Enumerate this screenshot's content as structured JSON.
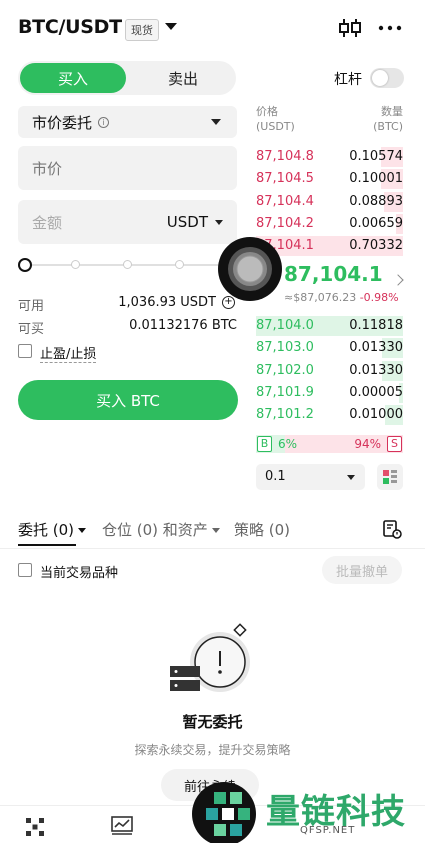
{
  "header": {
    "pair": "BTC/USDT",
    "badge": "现货"
  },
  "trade_panel": {
    "buy_tab": "买入",
    "sell_tab": "卖出",
    "leverage_label": "杠杆",
    "leverage_on": false,
    "order_type": "市价委托",
    "price_placeholder": "市价",
    "amount_placeholder": "金额",
    "amount_unit": "USDT",
    "slider_percent": 0,
    "available_label": "可用",
    "available_value": "1,036.93 USDT",
    "can_buy_label": "可买",
    "can_buy_value": "0.01132176 BTC",
    "tpsl_label": "止盈/止损",
    "buy_button": "买入 BTC"
  },
  "order_book": {
    "price_header": "价格",
    "price_unit": "(USDT)",
    "qty_header": "数量",
    "qty_unit": "(BTC)",
    "asks": [
      {
        "price": "87,104.8",
        "qty": "0.10574",
        "depth": 0.15
      },
      {
        "price": "87,104.5",
        "qty": "0.10001",
        "depth": 0.15
      },
      {
        "price": "87,104.4",
        "qty": "0.08893",
        "depth": 0.13
      },
      {
        "price": "87,104.2",
        "qty": "0.00659",
        "depth": 0.05
      },
      {
        "price": "87,104.1",
        "qty": "0.70332",
        "depth": 1.0
      }
    ],
    "mid_price": "87,104.1",
    "mid_usd": "≈$87,076.23",
    "mid_change": "-0.98%",
    "bids": [
      {
        "price": "87,104.0",
        "qty": "0.11818",
        "depth": 1.0
      },
      {
        "price": "87,103.0",
        "qty": "0.01330",
        "depth": 0.14
      },
      {
        "price": "87,102.0",
        "qty": "0.01330",
        "depth": 0.14
      },
      {
        "price": "87,101.9",
        "qty": "0.00005",
        "depth": 0.03
      },
      {
        "price": "87,101.2",
        "qty": "0.01000",
        "depth": 0.12
      }
    ],
    "buy_tag": "B",
    "buy_pct": "6%",
    "sell_tag": "S",
    "sell_pct": "94%",
    "depth_step": "0.1"
  },
  "tabs": {
    "orders": "委托 (0)",
    "positions": "仓位 (0) 和资产",
    "strategies": "策略 (0)"
  },
  "filter": {
    "current_pair_label": "当前交易品种",
    "batch_cancel": "批量撤单"
  },
  "empty_state": {
    "title": "暂无委托",
    "subtitle": "探索永续交易，提升交易策略",
    "button": "前往永续"
  },
  "watermark": {
    "text": "量链科技",
    "sub": "QFSP.NET"
  },
  "colors": {
    "green": "#2ebd5f",
    "red": "#d6325a",
    "watermark": "#2ea86a"
  }
}
